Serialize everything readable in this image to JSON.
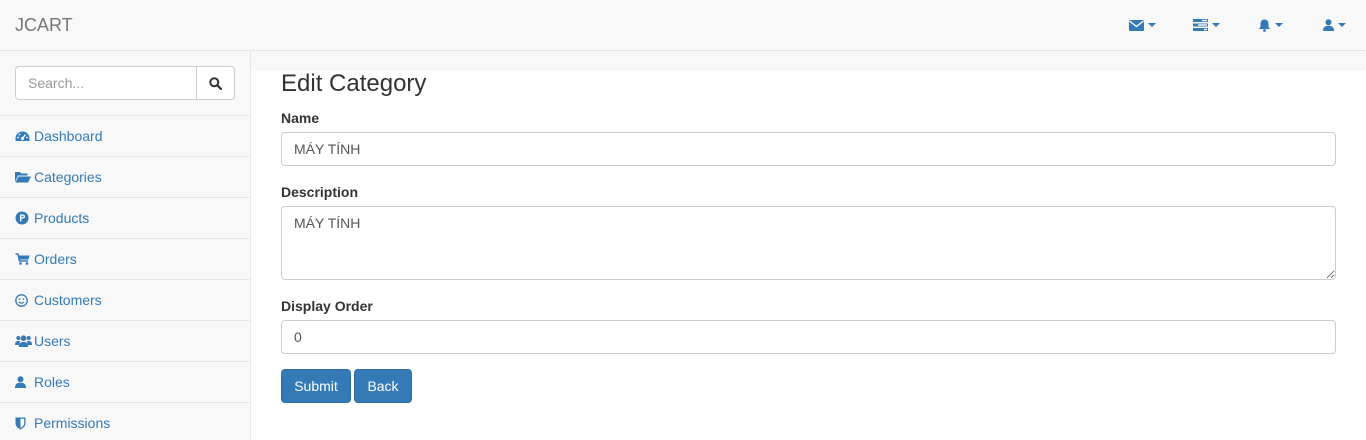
{
  "navbar": {
    "brand": "JCART",
    "icons": [
      {
        "icon": "envelope-icon"
      },
      {
        "icon": "tasks-icon"
      },
      {
        "icon": "bell-icon"
      },
      {
        "icon": "user-icon"
      }
    ]
  },
  "sidebar": {
    "search": {
      "placeholder": "Search...",
      "value": "",
      "icon": "search-icon"
    },
    "items": [
      {
        "label": "Dashboard",
        "icon": "dashboard-icon"
      },
      {
        "label": "Categories",
        "icon": "folder-open-icon"
      },
      {
        "label": "Products",
        "icon": "product-icon"
      },
      {
        "label": "Orders",
        "icon": "cart-icon"
      },
      {
        "label": "Customers",
        "icon": "smile-icon"
      },
      {
        "label": "Users",
        "icon": "users-icon"
      },
      {
        "label": "Roles",
        "icon": "user-icon"
      },
      {
        "label": "Permissions",
        "icon": "shield-icon"
      }
    ]
  },
  "form": {
    "title": "Edit Category",
    "name_label": "Name",
    "name_value": "MÁY TÍNH",
    "description_label": "Description",
    "description_value": "MÁY TÍNH",
    "display_order_label": "Display Order",
    "display_order_value": "0",
    "submit_label": "Submit",
    "back_label": "Back"
  },
  "colors": {
    "link": "#337ab7",
    "button": "#337ab7",
    "navbar_bg": "#f8f8f8"
  }
}
